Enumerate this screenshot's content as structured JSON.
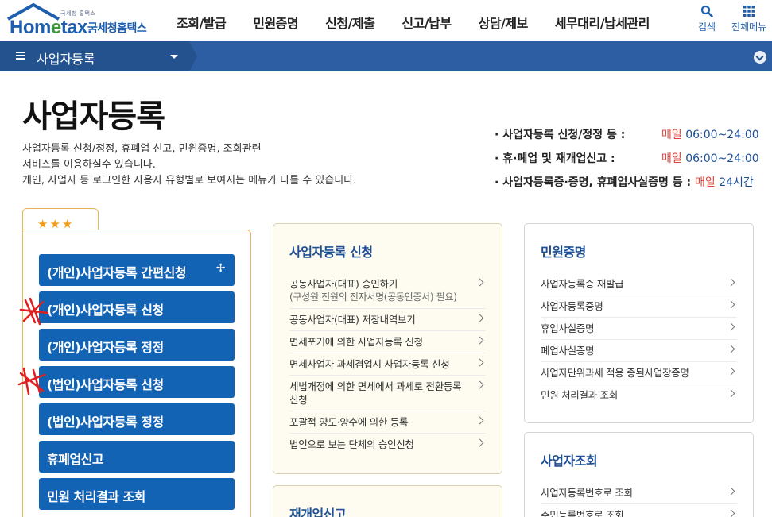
{
  "header": {
    "logo_tagline": "국세청 홈택스",
    "logo_brand_a": "Hom",
    "logo_brand_b": "e",
    "logo_brand_c": "tax.",
    "logo_korean": "국세청홈택스",
    "gnb": [
      "조회/발급",
      "민원증명",
      "신청/제출",
      "신고/납부",
      "상담/제보",
      "세무대리/납세관리"
    ],
    "search_label": "검색",
    "allmenu_label": "전체메뉴"
  },
  "location": {
    "current": "사업자등록"
  },
  "page": {
    "title": "사업자등록",
    "desc": [
      "사업자등록 신청/정정, 휴폐업 신고, 민원증명, 조회관련",
      "서비스를 이용하실수 있습니다.",
      "개인, 사업자 등 로그인한 사용자 유형별로 보여지는 메뉴가 다를 수 있습니다."
    ]
  },
  "hours": [
    {
      "label": "· 사업자등록 신청/정정 등 :",
      "day": "매일",
      "time": "06:00~24:00"
    },
    {
      "label": "· 휴·폐업 및 재개업신고 :",
      "day": "매일",
      "time": "06:00~24:00"
    },
    {
      "label": "· 사업자등록증·증명, 휴폐업사실증명 등 :",
      "day": "매일",
      "time": "24시간"
    }
  ],
  "favorites": {
    "stars": "★★★",
    "buttons": [
      "(개인)사업자등록 간편신청",
      "(개인)사업자등록 신청",
      "(개인)사업자등록 정정",
      "(법인)사업자등록 신청",
      "(법인)사업자등록 정정",
      "휴폐업신고",
      "민원 처리결과 조회"
    ],
    "pin_icon": "✢"
  },
  "cards": {
    "apply": {
      "title": "사업자등록 신청",
      "items": [
        {
          "text": "공동사업자(대표) 승인하기",
          "sub": "(구성원 전원의 전자서명(공동인증서) 필요)"
        },
        {
          "text": "공동사업자(대표) 저장내역보기",
          "sub": ""
        },
        {
          "text": "면세포기에 의한 사업자등록 신청",
          "sub": ""
        },
        {
          "text": "면세사업자 과세겸업시 사업자등록 신청",
          "sub": ""
        },
        {
          "text": "세법개정에 의한 면세에서 과세로 전환등록 신청",
          "sub": ""
        },
        {
          "text": "포괄적 양도·양수에 의한 등록",
          "sub": ""
        },
        {
          "text": "법인으로 보는 단체의 승인신청",
          "sub": ""
        }
      ]
    },
    "reopen": {
      "title": "재개업신고"
    },
    "cert": {
      "title": "민원증명",
      "items": [
        "사업자등록증 재발급",
        "사업자등록증명",
        "휴업사실증명",
        "폐업사실증명",
        "사업자단위과세 적용 종된사업장증명",
        "민원 처리결과 조회"
      ]
    },
    "lookup": {
      "title": "사업자조회",
      "items": [
        "사업자등록번호로 조회",
        "주민등록번호로 조회"
      ]
    }
  },
  "colors": {
    "brand_blue": "#1d5fae",
    "nav_bar": "#2d5ea3",
    "fav_button": "#1363b5",
    "accent_red": "#e2433b",
    "fav_border": "#e8b35a"
  }
}
